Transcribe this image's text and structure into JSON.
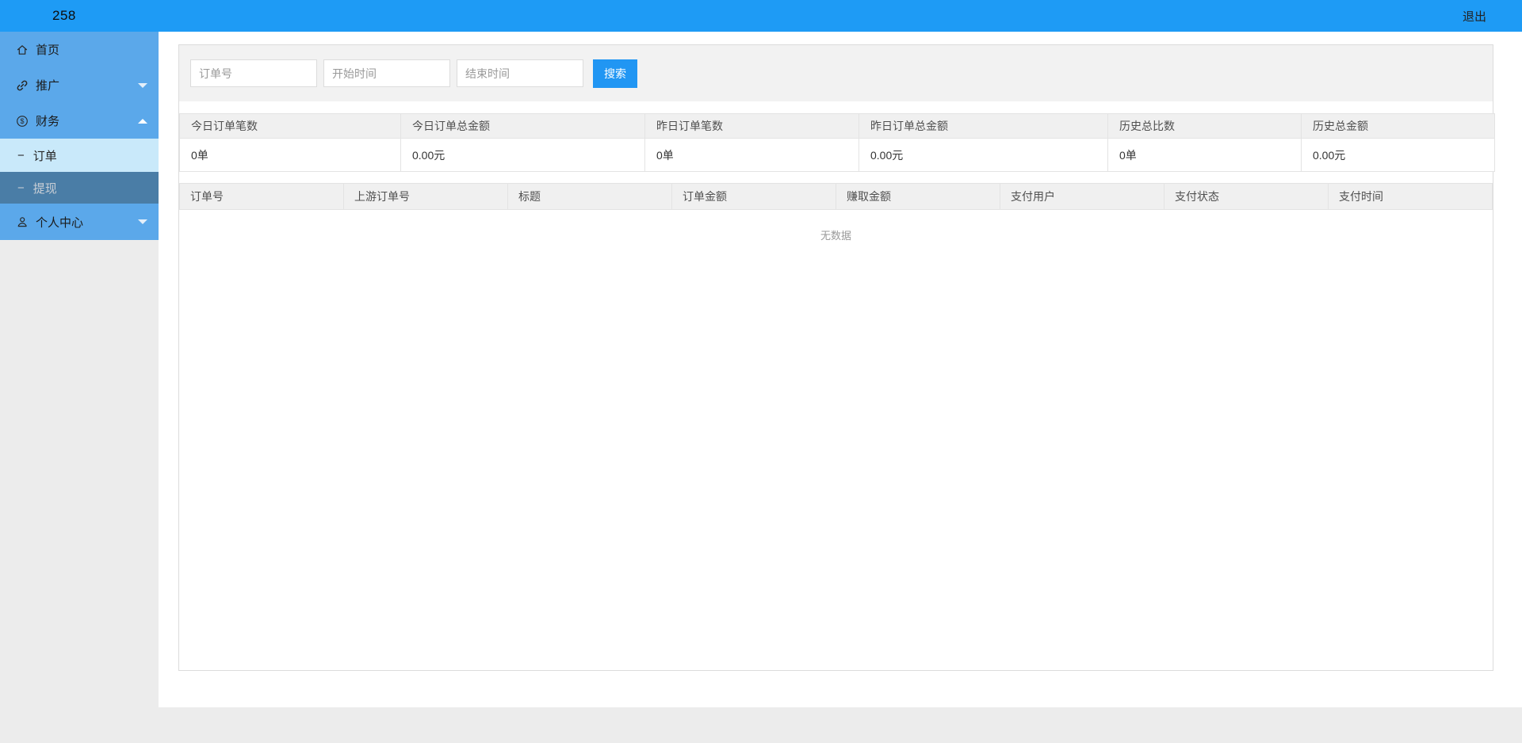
{
  "topbar": {
    "brand": "258",
    "logout_label": "退出"
  },
  "sidebar": {
    "items": [
      {
        "label": "首页",
        "icon": "home-icon"
      },
      {
        "label": "推广",
        "icon": "link-icon",
        "caret": "down"
      },
      {
        "label": "财务",
        "icon": "finance-icon",
        "caret": "up"
      },
      {
        "label": "个人中心",
        "icon": "user-icon",
        "caret": "down"
      }
    ],
    "subitems": [
      {
        "label": "订单",
        "state": "active"
      },
      {
        "label": "提现",
        "state": "inactive"
      }
    ],
    "dash_glyph": "−"
  },
  "search": {
    "order_no_placeholder": "订单号",
    "start_time_placeholder": "开始时间",
    "end_time_placeholder": "结束时间",
    "button_label": "搜索"
  },
  "stats": {
    "headers": [
      "今日订单笔数",
      "今日订单总金额",
      "昨日订单笔数",
      "昨日订单总金额",
      "历史总比数",
      "历史总金额"
    ],
    "values": [
      "0单",
      "0.00元",
      "0单",
      "0.00元",
      "0单",
      "0.00元"
    ]
  },
  "orders_table": {
    "headers": [
      "订单号",
      "上游订单号",
      "标题",
      "订单金额",
      "赚取金额",
      "支付用户",
      "支付状态",
      "支付时间"
    ],
    "empty_text": "无数据"
  },
  "colors": {
    "topbar_blue": "#1E9BF5",
    "sidebar_item_blue": "#5BA8EA",
    "active_subitem_blue": "#C9E9FA",
    "inactive_subitem_slate": "#4A7DA6",
    "accent_button_blue": "#2196F3",
    "panel_gray": "#F2F2F2",
    "table_header_gray": "#F0F0F0",
    "page_background": "#ECECEC"
  }
}
